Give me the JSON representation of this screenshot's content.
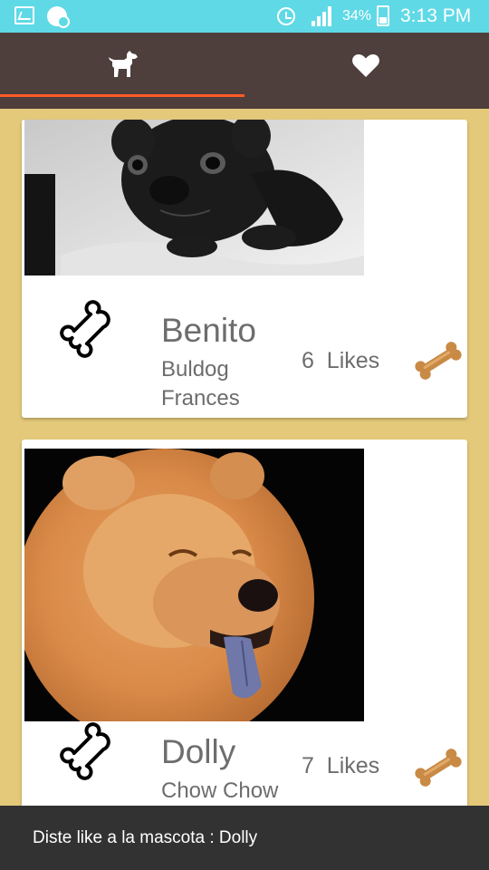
{
  "status_bar": {
    "battery_percent": "34%",
    "time": "3:13 PM",
    "icons": [
      "gallery-icon",
      "notification-icon",
      "alarm-icon",
      "signal-icon",
      "battery-charging-icon"
    ]
  },
  "tabs": [
    {
      "icon": "dog-icon",
      "selected": true
    },
    {
      "icon": "heart-icon",
      "selected": false
    }
  ],
  "colors": {
    "status_bar": "#5fd9e6",
    "tab_bar": "#4e3f3c",
    "tab_indicator": "#ff5a25",
    "background": "#e4c97a",
    "card": "#ffffff",
    "text": "#6d6d6d",
    "snackbar": "#323232"
  },
  "pets": [
    {
      "name": "Benito",
      "breed": "Buldog Frances",
      "likes": "6  Likes",
      "photo": "black french bulldog lying on a blanket"
    },
    {
      "name": "Dolly",
      "breed": "Chow Chow",
      "likes": "7  Likes",
      "photo": "chow chow with blue tongue"
    }
  ],
  "snackbar": {
    "message": "Diste like a la mascota : Dolly"
  }
}
